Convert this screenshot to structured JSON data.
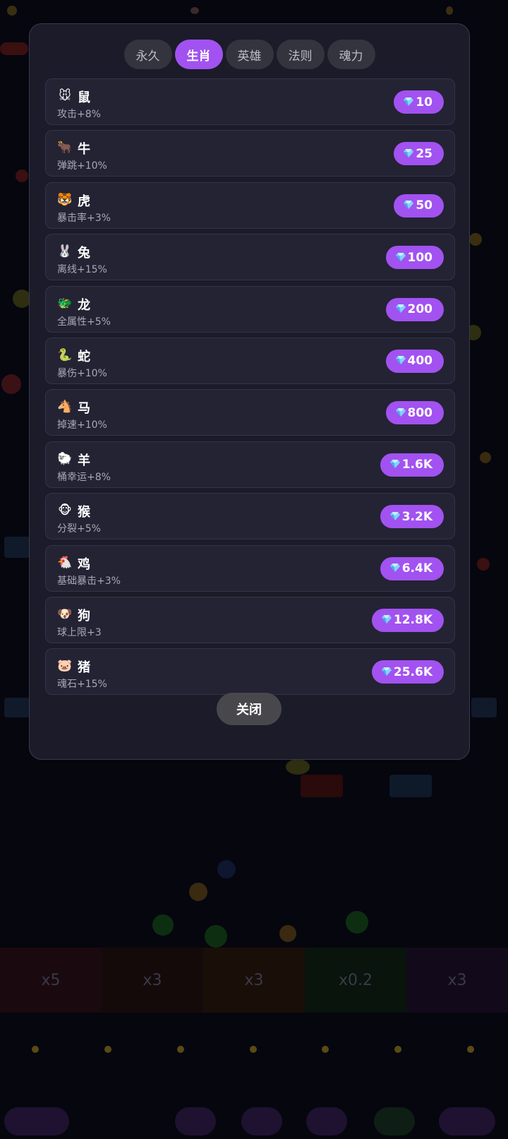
{
  "tabs": [
    {
      "label": "永久",
      "active": false
    },
    {
      "label": "生肖",
      "active": true
    },
    {
      "label": "英雄",
      "active": false
    },
    {
      "label": "法则",
      "active": false
    },
    {
      "label": "魂力",
      "active": false
    }
  ],
  "items": [
    {
      "icon": "🐭",
      "icon_name": "rat-icon",
      "name": "鼠",
      "desc": "攻击+8%",
      "price": "10"
    },
    {
      "icon": "🐂",
      "icon_name": "ox-icon",
      "name": "牛",
      "desc": "弹跳+10%",
      "price": "25"
    },
    {
      "icon": "🐯",
      "icon_name": "tiger-icon",
      "name": "虎",
      "desc": "暴击率+3%",
      "price": "50"
    },
    {
      "icon": "🐰",
      "icon_name": "rabbit-icon",
      "name": "兔",
      "desc": "离线+15%",
      "price": "100"
    },
    {
      "icon": "🐲",
      "icon_name": "dragon-icon",
      "name": "龙",
      "desc": "全属性+5%",
      "price": "200"
    },
    {
      "icon": "🐍",
      "icon_name": "snake-icon",
      "name": "蛇",
      "desc": "暴伤+10%",
      "price": "400"
    },
    {
      "icon": "🐴",
      "icon_name": "horse-icon",
      "name": "马",
      "desc": "掉速+10%",
      "price": "800"
    },
    {
      "icon": "🐑",
      "icon_name": "goat-icon",
      "name": "羊",
      "desc": "桶幸运+8%",
      "price": "1.6K"
    },
    {
      "icon": "🐵",
      "icon_name": "monkey-icon",
      "name": "猴",
      "desc": "分裂+5%",
      "price": "3.2K"
    },
    {
      "icon": "🐔",
      "icon_name": "rooster-icon",
      "name": "鸡",
      "desc": "基础暴击+3%",
      "price": "6.4K"
    },
    {
      "icon": "🐶",
      "icon_name": "dog-icon",
      "name": "狗",
      "desc": "球上限+3",
      "price": "12.8K"
    },
    {
      "icon": "🐷",
      "icon_name": "pig-icon",
      "name": "猪",
      "desc": "魂石+15%",
      "price": "25.6K"
    }
  ],
  "close_label": "关闭",
  "colors": {
    "accent": "#a252f0",
    "modal_bg": "#1b1b29",
    "row_bg": "#232334",
    "tab_bg": "#34343e",
    "close_bg": "#48484c"
  }
}
